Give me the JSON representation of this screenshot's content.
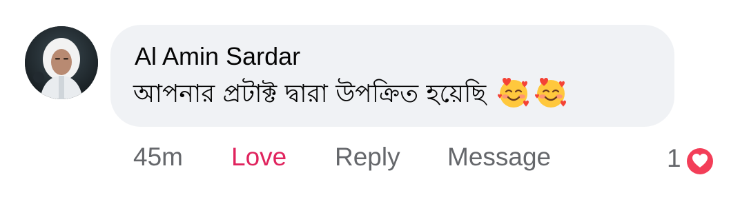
{
  "comment": {
    "author": "Al Amin Sardar",
    "text": "আপনার প্রটাক্ট দ্বারা উপক্রিত হয়েছি",
    "emojis": [
      "smiling-face-with-hearts",
      "smiling-face-with-hearts"
    ],
    "timestamp": "45m",
    "actions": {
      "love": "Love",
      "reply": "Reply",
      "message": "Message"
    },
    "reaction": {
      "count": "1",
      "icon": "heart-reaction-icon"
    }
  },
  "colors": {
    "bubble": "#f0f2f5",
    "love_active": "#e0245e",
    "muted_text": "#65676b",
    "heart_badge": "#f33e58"
  }
}
